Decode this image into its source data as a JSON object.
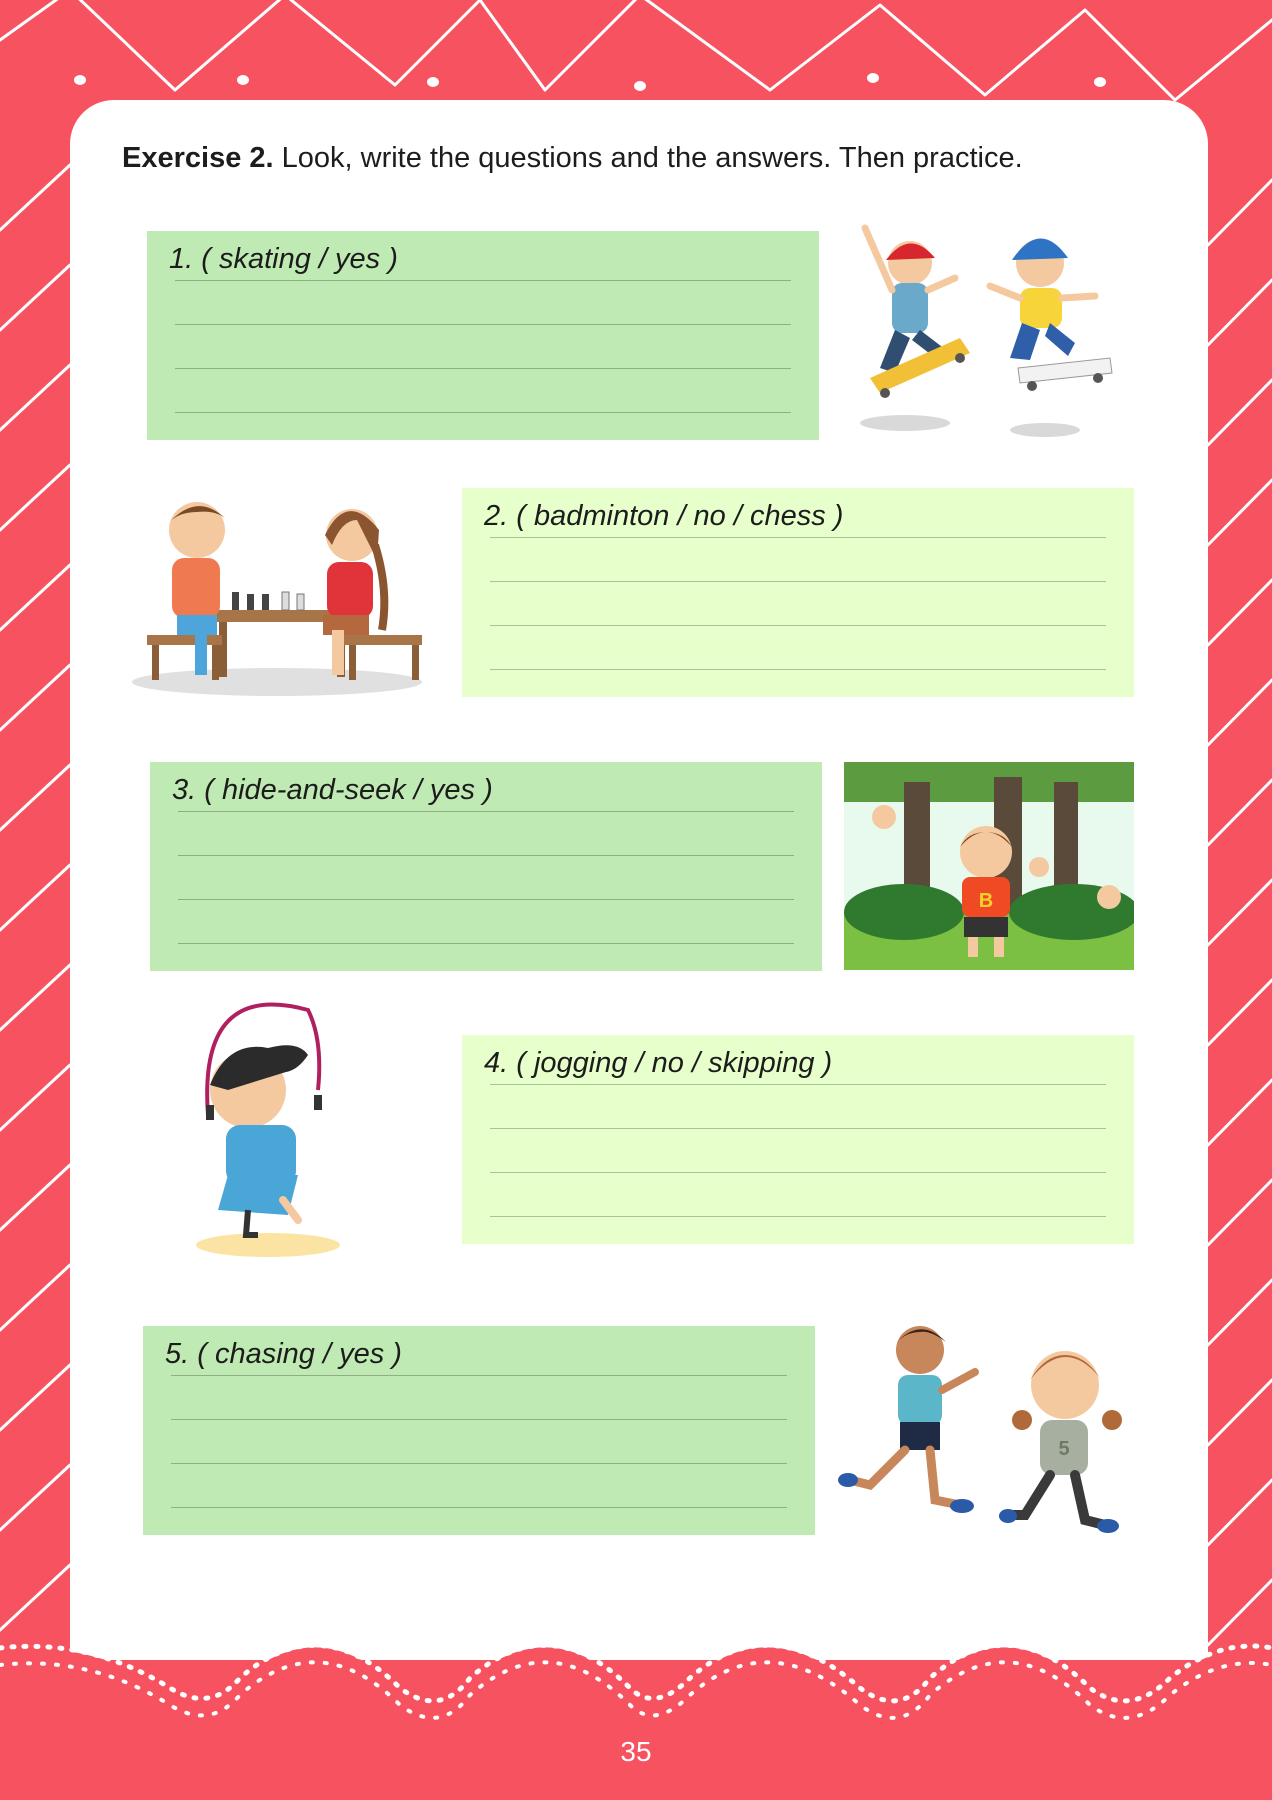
{
  "heading": {
    "bold": "Exercise 2.",
    "text": " Look, write the questions and the answers. Then practice."
  },
  "items": [
    {
      "label": "1. ( skating / yes )"
    },
    {
      "label": "2. ( badminton / no / chess )"
    },
    {
      "label": "3. ( hide-and-seek / yes )"
    },
    {
      "label": "4. ( jogging / no / skipping )"
    },
    {
      "label": "5. ( chasing / yes )"
    }
  ],
  "shirt_letters": {
    "hider": "B",
    "runner": "5"
  },
  "page_number": "35",
  "colors": {
    "border": "#f6525f",
    "box_dark": "#c0eab3",
    "box_light": "#e7ffca"
  },
  "illustrations": [
    "skateboarding-kids-illustration",
    "chess-playing-kids-illustration",
    "hide-and-seek-forest-illustration",
    "skipping-rope-girl-illustration",
    "chasing-kids-illustration"
  ]
}
